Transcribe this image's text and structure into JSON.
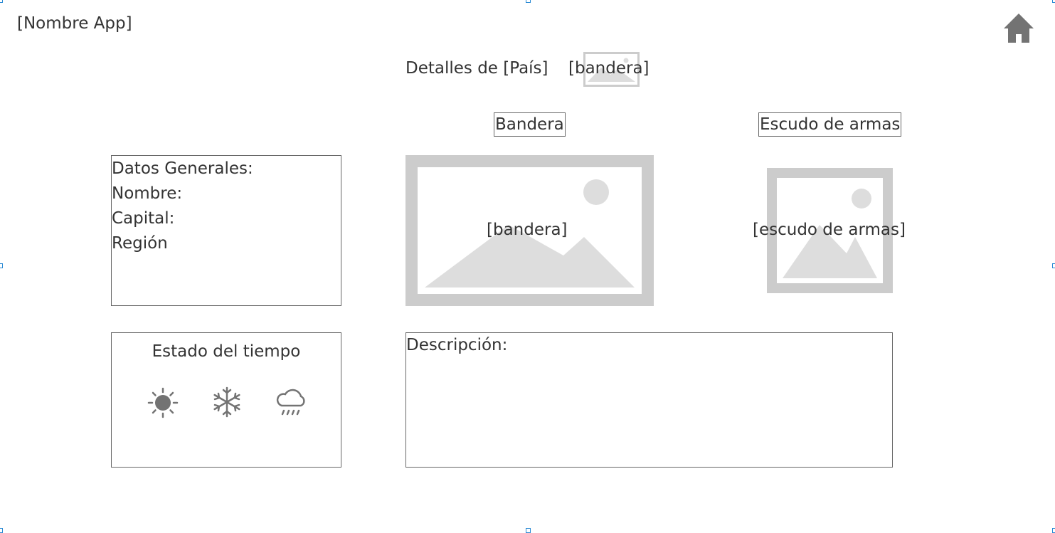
{
  "app": {
    "name": "[Nombre App]",
    "home_icon": "home-icon"
  },
  "header": {
    "title": "Detalles de [País]",
    "flag_placeholder": "[bandera]"
  },
  "flag_section": {
    "label": "Bandera",
    "image_text": "[bandera]"
  },
  "coat_section": {
    "label": "Escudo de armas",
    "image_text": "[escudo de armas]"
  },
  "general": {
    "lines": [
      "Datos Generales:",
      "Nombre:",
      "Capital:",
      "Región"
    ]
  },
  "weather": {
    "title": "Estado del tiempo",
    "icons": [
      "sun-icon",
      "snowflake-icon",
      "rain-cloud-icon"
    ]
  },
  "description": {
    "label": "Descripción:"
  },
  "colors": {
    "text": "#333333",
    "placeholder": "#cccccc",
    "icon": "#737373",
    "handle": "#2a8ad4"
  }
}
